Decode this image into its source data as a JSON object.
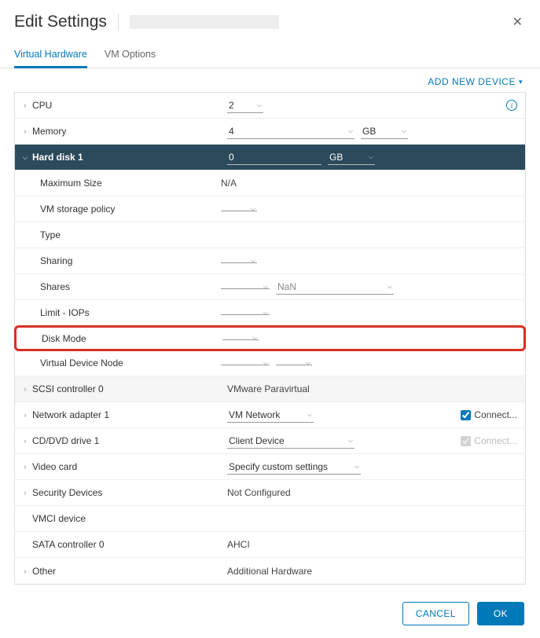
{
  "dialog": {
    "title": "Edit Settings"
  },
  "tabs": {
    "hardware": "Virtual Hardware",
    "options": "VM Options"
  },
  "toolbar": {
    "add_device": "ADD NEW DEVICE"
  },
  "rows": {
    "cpu": {
      "label": "CPU",
      "value": "2"
    },
    "memory": {
      "label": "Memory",
      "value": "4",
      "unit": "GB"
    },
    "hd1": {
      "label": "Hard disk 1",
      "value": "0",
      "unit": "GB"
    },
    "maxsize": {
      "label": "Maximum Size",
      "value": "N/A"
    },
    "storage_policy": {
      "label": "VM storage policy",
      "value": ""
    },
    "type": {
      "label": "Type",
      "value": ""
    },
    "sharing": {
      "label": "Sharing",
      "value": ""
    },
    "shares": {
      "label": "Shares",
      "value": "",
      "value2": "NaN"
    },
    "limit_iops": {
      "label": "Limit - IOPs",
      "value": ""
    },
    "disk_mode": {
      "label": "Disk Mode",
      "value": ""
    },
    "vdn": {
      "label": "Virtual Device Node",
      "value": "",
      "value2": ""
    },
    "scsi0": {
      "label": "SCSI controller 0",
      "value": "VMware Paravirtual"
    },
    "net1": {
      "label": "Network adapter 1",
      "value": "VM Network",
      "connect": "Connect..."
    },
    "cd1": {
      "label": "CD/DVD drive 1",
      "value": "Client Device",
      "connect": "Connect..."
    },
    "video": {
      "label": "Video card",
      "value": "Specify custom settings"
    },
    "security": {
      "label": "Security Devices",
      "value": "Not Configured"
    },
    "vmci": {
      "label": "VMCI device",
      "value": ""
    },
    "sata0": {
      "label": "SATA controller 0",
      "value": "AHCI"
    },
    "other": {
      "label": "Other",
      "value": "Additional Hardware"
    }
  },
  "footer": {
    "cancel": "CANCEL",
    "ok": "OK"
  }
}
